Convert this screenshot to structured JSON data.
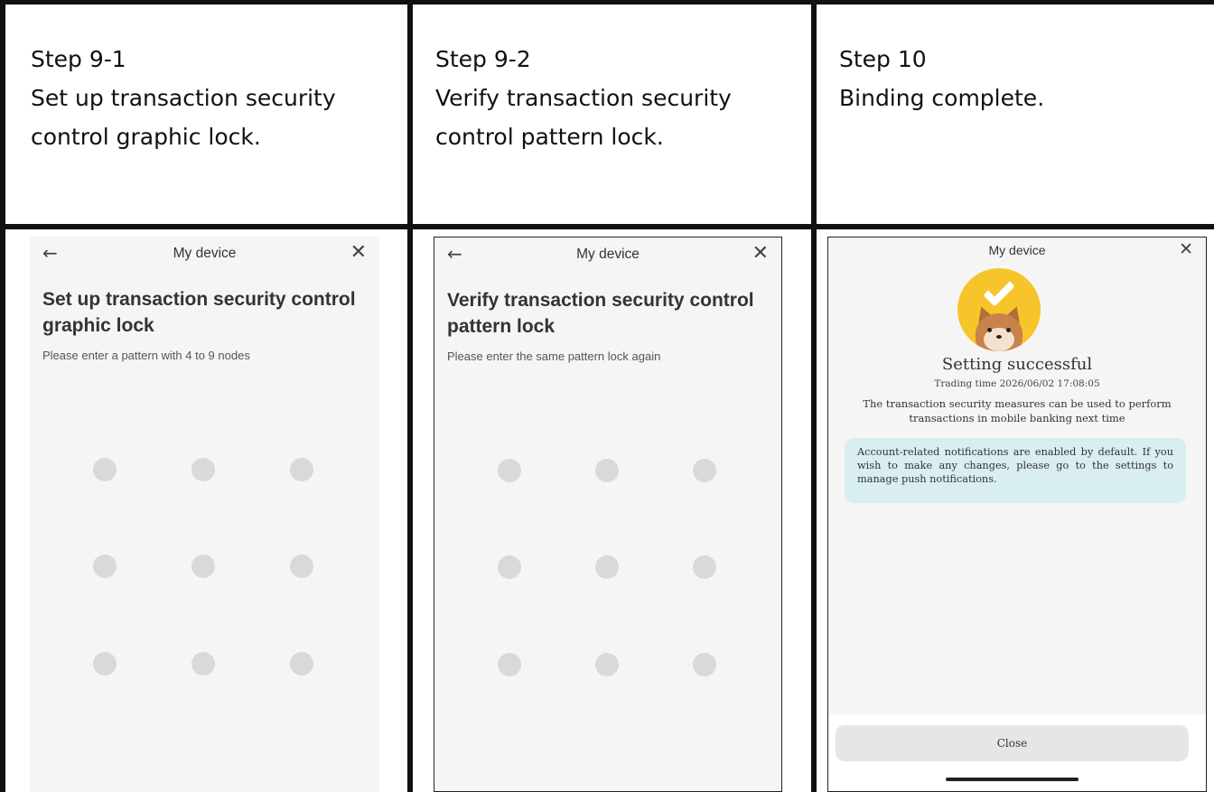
{
  "steps": [
    {
      "title": "Step 9-1",
      "description": "Set up transaction security control graphic lock.",
      "screen": {
        "header_title": "My device",
        "heading": "Set up transaction security control graphic lock",
        "subtitle": "Please enter a pattern with 4 to 9 nodes",
        "back_icon": "arrow-left-icon",
        "close_icon": "close-icon",
        "pattern_nodes": 9
      }
    },
    {
      "title": "Step 9-2",
      "description": "Verify transaction security control pattern lock.",
      "screen": {
        "header_title": "My device",
        "heading": "Verify transaction security control pattern lock",
        "subtitle": "Please enter the same pattern lock again",
        "back_icon": "arrow-left-icon",
        "close_icon": "close-icon",
        "pattern_nodes": 9
      }
    },
    {
      "title": "Step 10",
      "description": "Binding complete.",
      "screen": {
        "header_title": "My device",
        "close_icon": "close-icon",
        "result_title": "Setting successful",
        "trading_time": "Trading time 2026/06/02 17:08:05",
        "result_description": "The transaction security measures can be used to perform transactions in mobile banking next time",
        "notice": "Account-related notifications are enabled by default. If you wish to make any changes, please go to the settings to manage push notifications.",
        "close_button": "Close"
      }
    }
  ],
  "colors": {
    "panel_background": "#f5f5f5",
    "pattern_dot": "#d9d9d9",
    "notice_background": "#d8eef1",
    "success_badge": "#f6c52b",
    "border": "#111111"
  }
}
